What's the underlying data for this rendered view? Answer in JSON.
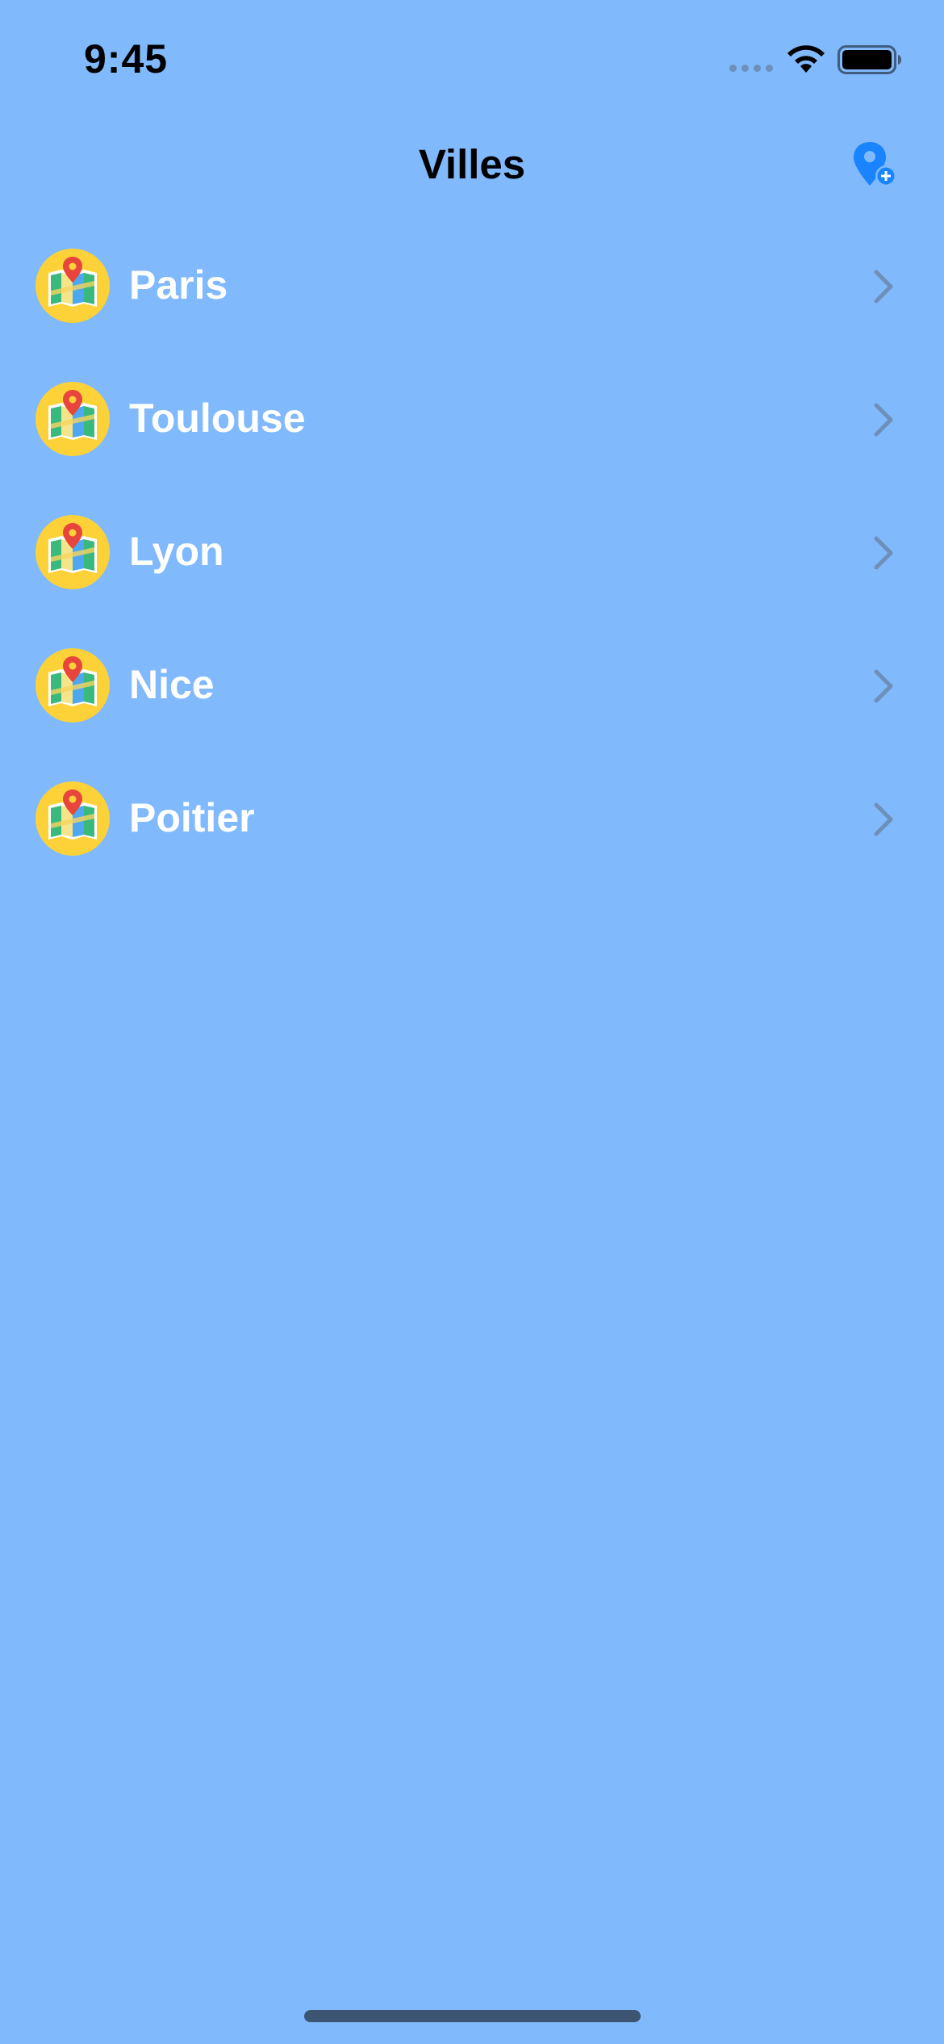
{
  "status_bar": {
    "time": "9:45",
    "icons": [
      "signal-dots-icon",
      "wifi-icon",
      "battery-icon"
    ]
  },
  "nav": {
    "title": "Villes",
    "add_button_icon": "location-pin-plus-icon",
    "accent_color": "#1a84ff"
  },
  "cities": [
    {
      "name": "Paris",
      "icon": "map-icon"
    },
    {
      "name": "Toulouse",
      "icon": "map-icon"
    },
    {
      "name": "Lyon",
      "icon": "map-icon"
    },
    {
      "name": "Nice",
      "icon": "map-icon"
    },
    {
      "name": "Poitier",
      "icon": "map-icon"
    }
  ],
  "colors": {
    "background": "#80b9fc",
    "row_text": "#ffffff",
    "chevron": "#6d8fb8",
    "icon_badge": "#fdd238"
  }
}
